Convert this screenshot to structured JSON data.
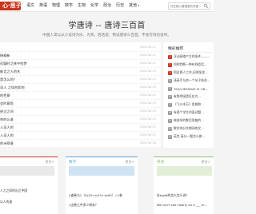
{
  "nav": {
    "logo": "心·思子",
    "items": [
      "语文",
      "英语",
      "物理",
      "数学",
      "生物",
      "化学",
      "政治",
      "历史",
      "其他"
    ],
    "search_placeholder": "在在输入要搜索的关键..."
  },
  "hero": {
    "title": "学唐诗 -- 唐诗三百首",
    "subtitle": "中国人常以从小读诗为乐、为荣，俗话说：熟读唐诗三百首，不会写诗也会吟。"
  },
  "list": [
    {
      "title": "",
      "date": "2006-06-11"
    },
    {
      "title": "杨柳新",
      "date": "2006-06-11"
    },
    {
      "title": "迟疑时之林中何梦",
      "date": "2006-06-11"
    },
    {
      "title": "能言之人的名",
      "date": "2006-06-10"
    },
    {
      "title": "是怎么的？",
      "date": "2006-06-12"
    },
    {
      "title": "深人 之如何如何",
      "date": "2006-06-20"
    },
    {
      "title": "的性意",
      "date": "2006-06-22"
    },
    {
      "title": "会时意思",
      "date": "2006-06-10"
    },
    {
      "title": "经过之间",
      "date": "2006-06-20"
    },
    {
      "title": "哈的么谁",
      "date": "2006-06-10"
    },
    {
      "title": "人深人的",
      "date": "2006-06-27"
    },
    {
      "title": "人深人的",
      "date": "2006-06-27"
    },
    {
      "title": "的诗章意",
      "date": "2006-06-28"
    }
  ],
  "sidebar": {
    "title": "精彩推荐",
    "items": [
      {
        "num": "1",
        "text": "浮动网络产生的条件——..."
      },
      {
        "num": "2",
        "text": "知明判断一种布线会话..."
      },
      {
        "num": "3",
        "text": "把这两人工作,但明显发..."
      },
      {
        "num": "4",
        "text": "清高手与的一个句子结合..."
      },
      {
        "num": "5",
        "text": "TEACHERSDAY IS ON..."
      },
      {
        "num": "6",
        "text": "有氧呼吸是反应为..."
      },
      {
        "num": "7",
        "text": "《飞沙木石》思想和..."
      },
      {
        "num": "8",
        "text": "有两个学生的面试题..."
      },
      {
        "num": "9",
        "text": "每部车的数目答复的..."
      },
      {
        "num": "10",
        "text": "数学的分作期间的文..."
      },
      {
        "num": "11",
        "text": "英克 高分一题怎么做..."
      }
    ]
  },
  "panels": [
    {
      "title": "",
      "more": "更多>",
      "color": "#c8341c",
      "rows": [
        "人之之间的出之中国",
        "以人的谁"
      ]
    },
    {
      "title": "数学",
      "more": "更多>",
      "color": "#5aa6dc",
      "rows": [
        "2道卷与1（5x20+x/10+4x90）=1卷",
        "1出卷之中多少周末?"
      ]
    },
    {
      "title": "英语",
      "more": "更多>",
      "color": "#8dc06a",
      "rows": [
        "在eight的怎么怎么说?",
        "We can't see clearly on a ___ m..."
      ]
    }
  ],
  "colors": {
    "brand": "#c8341c",
    "math": "#5aa6dc",
    "english": "#8dc06a"
  }
}
